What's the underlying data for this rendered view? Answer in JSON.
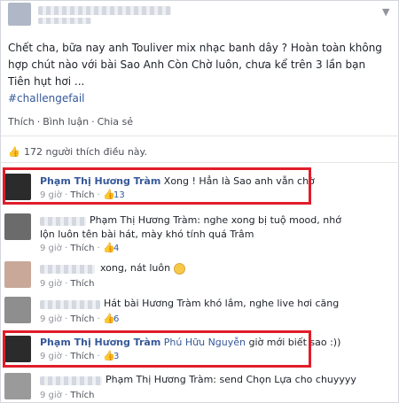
{
  "post": {
    "text_line1": "Chết cha, bữa nay anh Touliver mix nhạc banh dây ? Hoàn toàn không",
    "text_line2": "hợp chút nào với bài Sao Anh Còn Chờ luôn, chưa kể trên 3 lần bạn",
    "text_line3": "Tiên hụt hơi ...",
    "hashtag": "#challengefail",
    "actions": {
      "like": "Thích",
      "comment": "Bình luận",
      "share": "Chia sẻ"
    },
    "likes_summary": "172 người thích điều này."
  },
  "comments": [
    {
      "name": "Phạm Thị Hương Tràm",
      "text": "Xong ! Hẳn là Sao anh vẫn chờ",
      "time": "9 giờ",
      "like": "Thích",
      "likes": "13"
    },
    {
      "name": "Phạm Thị Hương Tràm",
      "text_a": "Phạm Thị Hương Tràm: nghe xong bị tuộ mood, nhớ",
      "text_b": "lộn luôn tên bài hát, mày khó tính quá Trâm",
      "time": "9 giờ",
      "like": "Thích",
      "likes": "4"
    },
    {
      "text": "xong, nát luôn",
      "time": "9 giờ",
      "like": "Thích"
    },
    {
      "text": "Hát bài Hương Tràm khó lắm, nghe live hơi căng",
      "time": "9 giờ",
      "like": "Thích",
      "likes": "6"
    },
    {
      "name": "Phạm Thị Hương Tràm",
      "mention": "Phú Hữu Nguyễn",
      "text": "giờ mới biết sao :))",
      "time": "9 giờ",
      "like": "Thích",
      "likes": "3"
    },
    {
      "text": "Phạm Thị Hương Tràm: send Chọn Lựa cho chuyyyy",
      "time": "9 giờ",
      "like": "Thích"
    }
  ],
  "colors": {
    "link": "#365899",
    "highlight": "#e11d2a"
  }
}
